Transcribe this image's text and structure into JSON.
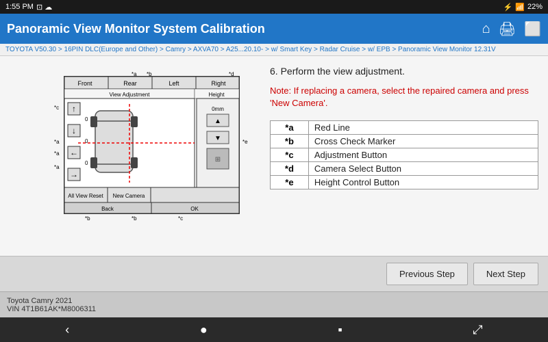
{
  "status_bar": {
    "time": "1:55 PM",
    "battery": "22%"
  },
  "header": {
    "title": "Panoramic View Monitor System Calibration",
    "home_icon": "⌂",
    "print_icon": "🖨",
    "export_icon": "⬛"
  },
  "breadcrumb": {
    "text": "TOYOTA V50.30 > 16PIN DLC(Europe and Other) > Camry > AXVA70 > A25...20.10- > w/ Smart Key > Radar Cruise > w/ EPB > Panoramic View Monitor  12.31V"
  },
  "content": {
    "step_text": "6. Perform the view adjustment.",
    "note_text": "Note: If replacing a camera, select the repaired camera and press 'New Camera'.",
    "legend": [
      {
        "key": "*a",
        "label": "Red Line"
      },
      {
        "key": "*b",
        "label": "Cross Check Marker"
      },
      {
        "key": "*c",
        "label": "Adjustment Button"
      },
      {
        "key": "*d",
        "label": "Camera Select Button"
      },
      {
        "key": "*e",
        "label": "Height Control Button"
      }
    ]
  },
  "buttons": {
    "previous": "Previous Step",
    "next": "Next Step"
  },
  "footer": {
    "line1": "Toyota Camry 2021",
    "line2": "VIN 4T1B61AK*M8006311"
  }
}
